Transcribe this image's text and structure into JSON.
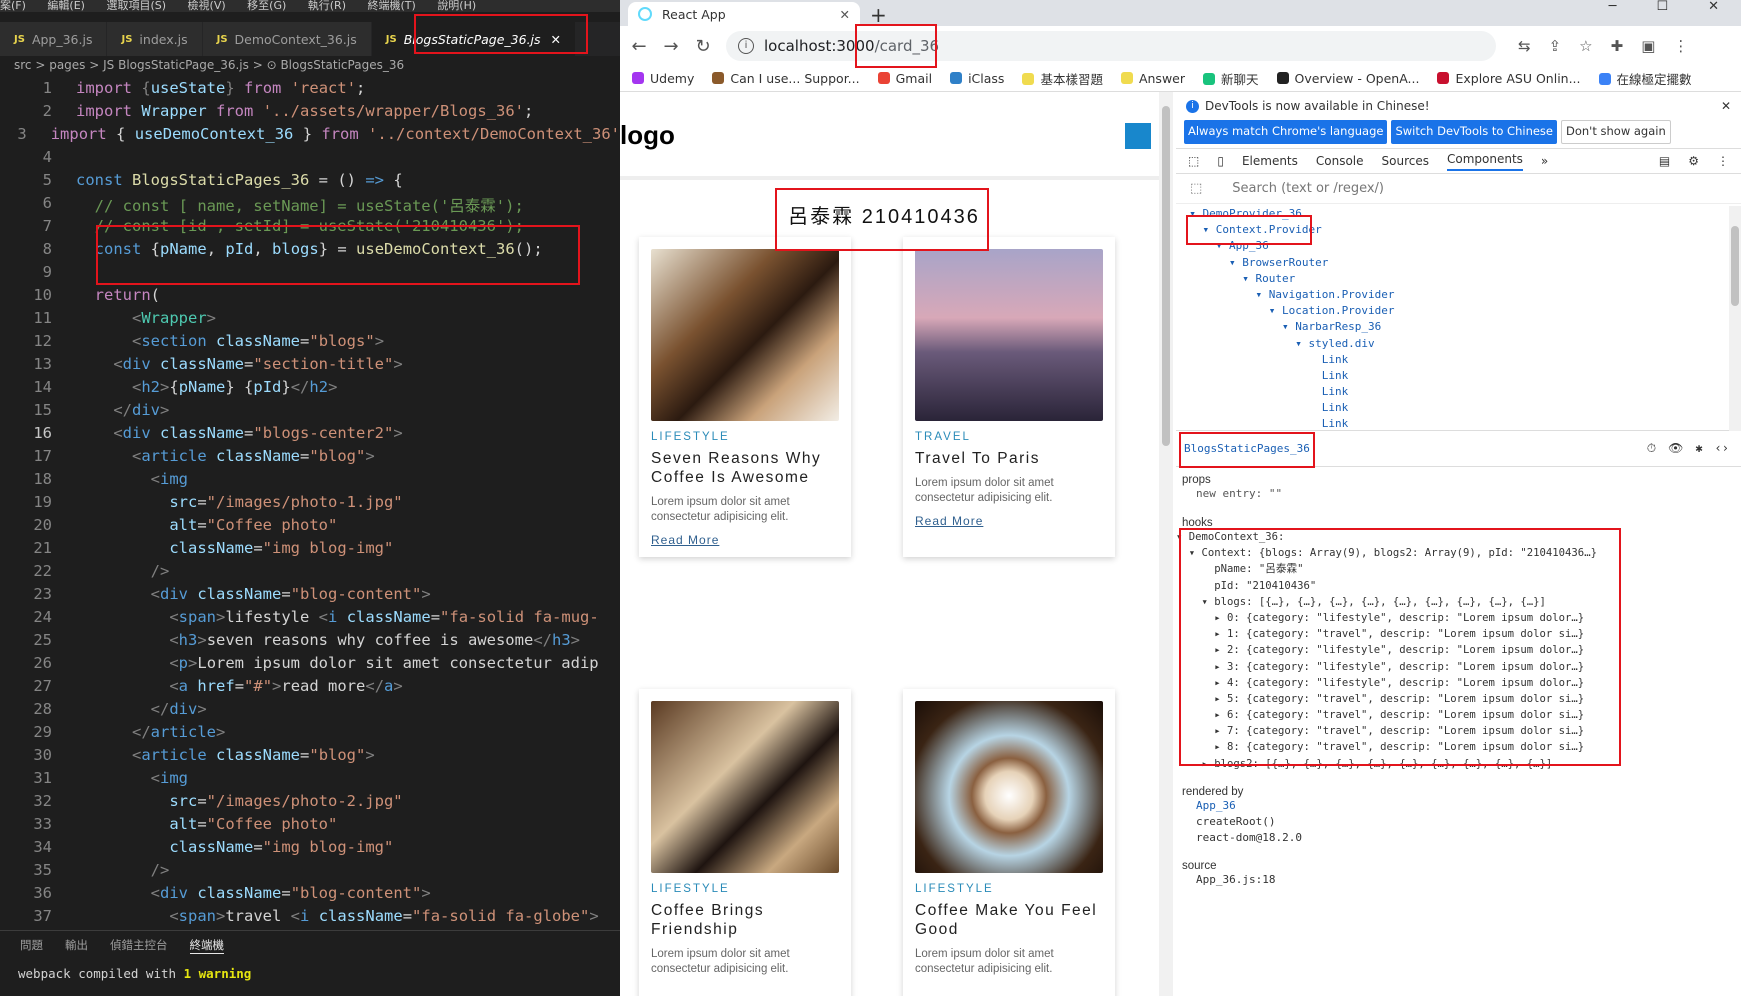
{
  "editor": {
    "menu": [
      "案(F)",
      "編輯(E)",
      "選取項目(S)",
      "檢視(V)",
      "移至(G)",
      "執行(R)",
      "終端機(T)",
      "說明(H)"
    ],
    "tabs": [
      {
        "label": "App_36.js",
        "active": false
      },
      {
        "label": "index.js",
        "active": false
      },
      {
        "label": "DemoContext_36.js",
        "active": false
      },
      {
        "label": "BlogsStaticPage_36.js",
        "active": true
      }
    ],
    "breadcrumb": "src > pages > JS BlogsStaticPage_36.js > ⊙ BlogsStaticPages_36",
    "lines": [
      {
        "n": "1",
        "h": "<span class='kf'>import</span> <span class='p'>{</span><span class='v'>useState</span><span class='p'>}</span> <span class='kf'>from</span> <span class='s'>'react'</span>;"
      },
      {
        "n": "2",
        "h": "<span class='kf'>import</span> <span class='v'>Wrapper</span> <span class='kf'>from</span> <span class='s'>'../assets/wrapper/Blogs_36'</span>;"
      },
      {
        "n": "3",
        "h": "<span class='kf'>import</span> { <span class='v'>useDemoContext_36</span> } <span class='kf'>from</span> <span class='s'>'../context/DemoContext_36'</span>"
      },
      {
        "n": "4",
        "h": ""
      },
      {
        "n": "5",
        "h": "<span class='k'>const</span> <span class='f'>BlogsStaticPages_36</span> = () <span class='k'>=&gt;</span> {"
      },
      {
        "n": "6",
        "h": "  <span class='c'>// const [ name, setName] = useState('呂泰霖');</span>"
      },
      {
        "n": "7",
        "h": "  <span class='c'>// const [id , setId] = useState('210410436');</span>"
      },
      {
        "n": "8",
        "h": "  <span class='k'>const</span> {<span class='v'>pName</span>, <span class='v'>pId</span>, <span class='v'>blogs</span>} = <span class='f'>useDemoContext_36</span>();"
      },
      {
        "n": "9",
        "h": ""
      },
      {
        "n": "10",
        "h": "  <span class='kf'>return</span>("
      },
      {
        "n": "11",
        "h": "      <span class='p'>&lt;</span><span class='t'>Wrapper</span><span class='p'>&gt;</span>"
      },
      {
        "n": "12",
        "h": "      <span class='p'>&lt;</span><span class='tg'>section</span> <span class='at'>className</span>=<span class='s'>\"blogs\"</span><span class='p'>&gt;</span>"
      },
      {
        "n": "13",
        "h": "    <span class='p'>&lt;</span><span class='tg'>div</span> <span class='at'>className</span>=<span class='s'>\"section-title\"</span><span class='p'>&gt;</span>"
      },
      {
        "n": "14",
        "h": "      <span class='p'>&lt;</span><span class='tg'>h2</span><span class='p'>&gt;</span>{<span class='v'>pName</span>} {<span class='v'>pId</span>}<span class='p'>&lt;/</span><span class='tg'>h2</span><span class='p'>&gt;</span>"
      },
      {
        "n": "15",
        "h": "    <span class='p'>&lt;/</span><span class='tg'>div</span><span class='p'>&gt;</span>"
      },
      {
        "n": "16",
        "h": "    <span class='p'>&lt;</span><span class='tg'>div</span> <span class='at'>className</span>=<span class='s'>\"blogs-center2\"</span><span class='p'>&gt;</span>"
      },
      {
        "n": "17",
        "h": "      <span class='p'>&lt;</span><span class='tg'>article</span> <span class='at'>className</span>=<span class='s'>\"blog\"</span><span class='p'>&gt;</span>"
      },
      {
        "n": "18",
        "h": "        <span class='p'>&lt;</span><span class='tg'>img</span>"
      },
      {
        "n": "19",
        "h": "          <span class='at'>src</span>=<span class='s'>\"/images/photo-1.jpg\"</span>"
      },
      {
        "n": "20",
        "h": "          <span class='at'>alt</span>=<span class='s'>\"Coffee photo\"</span>"
      },
      {
        "n": "21",
        "h": "          <span class='at'>className</span>=<span class='s'>\"img blog-img\"</span>"
      },
      {
        "n": "22",
        "h": "        <span class='p'>/&gt;</span>"
      },
      {
        "n": "23",
        "h": "        <span class='p'>&lt;</span><span class='tg'>div</span> <span class='at'>className</span>=<span class='s'>\"blog-content\"</span><span class='p'>&gt;</span>"
      },
      {
        "n": "24",
        "h": "          <span class='p'>&lt;</span><span class='tg'>span</span><span class='p'>&gt;</span>lifestyle <span class='p'>&lt;</span><span class='tg'>i</span> <span class='at'>className</span>=<span class='s'>\"fa-solid fa-mug-</span>"
      },
      {
        "n": "25",
        "h": "          <span class='p'>&lt;</span><span class='tg'>h3</span><span class='p'>&gt;</span>seven reasons why coffee is awesome<span class='p'>&lt;/</span><span class='tg'>h3</span><span class='p'>&gt;</span>"
      },
      {
        "n": "26",
        "h": "          <span class='p'>&lt;</span><span class='tg'>p</span><span class='p'>&gt;</span>Lorem ipsum dolor sit amet consectetur adip"
      },
      {
        "n": "27",
        "h": "          <span class='p'>&lt;</span><span class='tg'>a</span> <span class='at'>href</span>=<span class='s'>\"#\"</span><span class='p'>&gt;</span>read more<span class='p'>&lt;/</span><span class='tg'>a</span><span class='p'>&gt;</span>"
      },
      {
        "n": "28",
        "h": "        <span class='p'>&lt;/</span><span class='tg'>div</span><span class='p'>&gt;</span>"
      },
      {
        "n": "29",
        "h": "      <span class='p'>&lt;/</span><span class='tg'>article</span><span class='p'>&gt;</span>"
      },
      {
        "n": "30",
        "h": "      <span class='p'>&lt;</span><span class='tg'>article</span> <span class='at'>className</span>=<span class='s'>\"blog\"</span><span class='p'>&gt;</span>"
      },
      {
        "n": "31",
        "h": "        <span class='p'>&lt;</span><span class='tg'>img</span>"
      },
      {
        "n": "32",
        "h": "          <span class='at'>src</span>=<span class='s'>\"/images/photo-2.jpg\"</span>"
      },
      {
        "n": "33",
        "h": "          <span class='at'>alt</span>=<span class='s'>\"Coffee photo\"</span>"
      },
      {
        "n": "34",
        "h": "          <span class='at'>className</span>=<span class='s'>\"img blog-img\"</span>"
      },
      {
        "n": "35",
        "h": "        <span class='p'>/&gt;</span>"
      },
      {
        "n": "36",
        "h": "        <span class='p'>&lt;</span><span class='tg'>div</span> <span class='at'>className</span>=<span class='s'>\"blog-content\"</span><span class='p'>&gt;</span>"
      },
      {
        "n": "37",
        "h": "          <span class='p'>&lt;</span><span class='tg'>span</span><span class='p'>&gt;</span>travel <span class='p'>&lt;</span><span class='tg'>i</span> <span class='at'>className</span>=<span class='s'>\"fa-solid fa-globe\"</span><span class='p'>&gt;</span>"
      }
    ],
    "panel_tabs": [
      "問題",
      "輸出",
      "偵錯主控台",
      "終端機"
    ],
    "terminal": {
      "prefix": "webpack compiled with ",
      "count": "1",
      "suffix": " warning"
    }
  },
  "browser": {
    "tab_title": "React App",
    "url_host": "localhost:3000",
    "url_path": "/card_36",
    "bookmarks": [
      "Udemy",
      "Can I use... Suppor...",
      "Gmail",
      "iClass",
      "基本樣習題",
      "Answer",
      "新聊天",
      "Overview - OpenA...",
      "Explore ASU Onlin...",
      "在線極定擺數"
    ]
  },
  "page": {
    "logo": "logo",
    "heading": "呂泰霖 210410436",
    "cards": [
      {
        "category": "LIFESTYLE",
        "title": "Seven Reasons Why Coffee Is Awesome",
        "desc": "Lorem ipsum dolor sit amet consectetur adipisicing elit.",
        "link": "Read More"
      },
      {
        "category": "TRAVEL",
        "title": "Travel To Paris",
        "desc": "Lorem ipsum dolor sit amet consectetur adipisicing elit.",
        "link": "Read More"
      },
      {
        "category": "LIFESTYLE",
        "title": "Coffee Brings Friendship",
        "desc": "Lorem ipsum dolor sit amet consectetur adipisicing elit.",
        "link": ""
      },
      {
        "category": "LIFESTYLE",
        "title": "Coffee Make You Feel Good",
        "desc": "Lorem ipsum dolor sit amet consectetur adipisicing elit.",
        "link": ""
      }
    ]
  },
  "devtools": {
    "notice": "DevTools is now available in Chinese!",
    "btn_match": "Always match Chrome's language",
    "btn_switch": "Switch DevTools to Chinese",
    "btn_dont": "Don't show again",
    "tabs": [
      "Elements",
      "Console",
      "Sources",
      "Components"
    ],
    "search_placeholder": "Search (text or /regex/)",
    "tree": [
      "  ▾ DemoProvider_36",
      "    ▾ Context.Provider",
      "      ▾ App_36",
      "        ▾ BrowserRouter",
      "          ▾ Router",
      "            ▾ Navigation.Provider",
      "              ▾ Location.Provider",
      "                ▾ NarbarResp_36",
      "                  ▾ styled.div",
      "                      Link",
      "                      Link",
      "                      Link",
      "                      Link",
      "                      Link"
    ],
    "selected": "BlogsStaticPages_36",
    "props_label": "props",
    "props_line": "new entry: \"\"",
    "hooks_label": "hooks",
    "hooks": [
      "▾ DemoContext_36:",
      "  ▾ Context: {blogs: Array(9), blogs2: Array(9), pId: \"210410436…}",
      "      pName: \"呂泰霖\"",
      "      pId: \"210410436\"",
      "    ▾ blogs: [{…}, {…}, {…}, {…}, {…}, {…}, {…}, {…}, {…}]",
      "      ▸ 0: {category: \"lifestyle\", descrip: \"Lorem ipsum dolor…}",
      "      ▸ 1: {category: \"travel\", descrip: \"Lorem ipsum dolor si…}",
      "      ▸ 2: {category: \"lifestyle\", descrip: \"Lorem ipsum dolor…}",
      "      ▸ 3: {category: \"lifestyle\", descrip: \"Lorem ipsum dolor…}",
      "      ▸ 4: {category: \"lifestyle\", descrip: \"Lorem ipsum dolor…}",
      "      ▸ 5: {category: \"travel\", descrip: \"Lorem ipsum dolor si…}",
      "      ▸ 6: {category: \"travel\", descrip: \"Lorem ipsum dolor si…}",
      "      ▸ 7: {category: \"travel\", descrip: \"Lorem ipsum dolor si…}",
      "      ▸ 8: {category: \"travel\", descrip: \"Lorem ipsum dolor si…}",
      "    ▸ blogs2: [{…}, {…}, {…}, {…}, {…}, {…}, {…}, {…}, {…}]"
    ],
    "rendered_label": "rendered by",
    "rendered": [
      "App_36",
      "createRoot()",
      "react-dom@18.2.0"
    ],
    "source_label": "source",
    "source": "App_36.js:18"
  }
}
